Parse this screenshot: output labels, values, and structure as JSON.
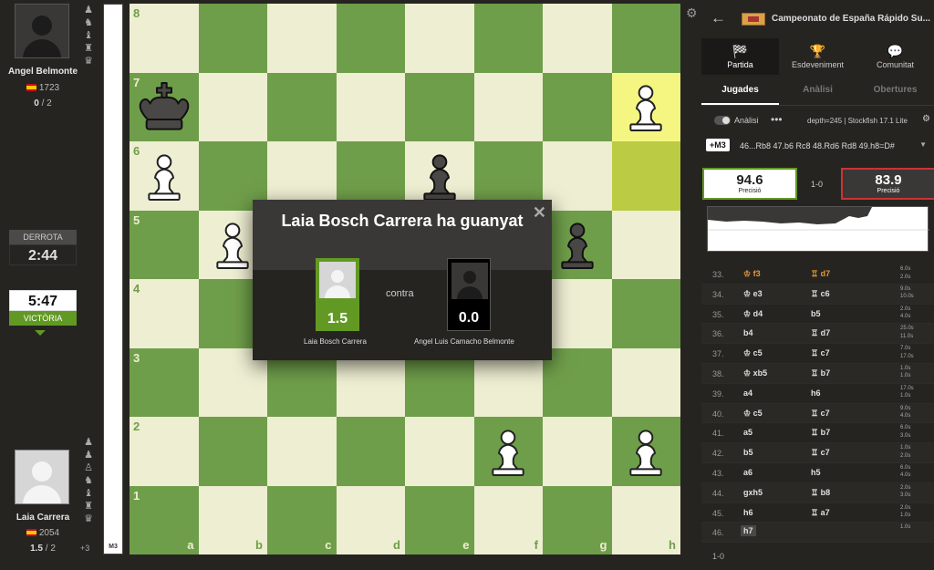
{
  "top_player": {
    "name": "Angel Belmonte",
    "rating": "1723",
    "score": "0",
    "score_total": "/ 2",
    "captured": [
      "♟",
      "♞",
      "♝",
      "♜",
      "♛"
    ]
  },
  "bottom_player": {
    "name": "Laia Carrera",
    "rating": "2054",
    "score": "1.5",
    "score_total": "/ 2",
    "captured": [
      "♟",
      "♟",
      "♙",
      "♞",
      "♝",
      "♜",
      "♛"
    ],
    "material_diff": "+3"
  },
  "clocks": {
    "top": {
      "label": "DERROTA",
      "time": "2:44"
    },
    "bottom": {
      "label": "VICTÒRIA",
      "time": "5:47"
    }
  },
  "eval_bar": {
    "label": "M3"
  },
  "board": {
    "ranks": [
      "8",
      "7",
      "6",
      "5",
      "4",
      "3",
      "2",
      "1"
    ],
    "files": [
      "a",
      "b",
      "c",
      "d",
      "e",
      "f",
      "g",
      "h"
    ]
  },
  "modal": {
    "title": "Laia Bosch Carrera ha guanyat",
    "close": "✕",
    "vs": "contra",
    "winner": {
      "name": "Laia Bosch Carrera",
      "score": "1.5"
    },
    "loser": {
      "name": "Angel Luis Camacho Belmonte",
      "score": "0.0"
    }
  },
  "panel": {
    "back": "←",
    "tournament": "Campeonato de España Rápido Su...",
    "main_tabs": [
      {
        "icon": "checkered-flag",
        "label": "Partida"
      },
      {
        "icon": "trophy",
        "label": "Esdeveniment"
      },
      {
        "icon": "chat",
        "label": "Comunitat"
      }
    ],
    "sub_tabs": [
      "Jugades",
      "Anàlisi",
      "Obertures"
    ],
    "analysis_label": "Anàlisi",
    "dots": "•••",
    "depth": "depth=245 | Stockfish 17.1 Lite",
    "pv_badge": "+M3",
    "pv_line": "46...Rb8 47.b6 Rc8 48.Rd6 Rd8 49.h8=D#",
    "accuracy": {
      "white": "94.6",
      "black": "83.9",
      "label": "Precisió",
      "result": "1-0"
    },
    "moves": [
      {
        "n": "33.",
        "w": "♔ f3",
        "b": "♖ d7",
        "t": [
          "6.0s",
          "2.0s"
        ]
      },
      {
        "n": "34.",
        "w": "♔ e3",
        "b": "♖ c6",
        "t": [
          "9.0s",
          "10.0s"
        ]
      },
      {
        "n": "35.",
        "w": "♔ d4",
        "b": "b5",
        "t": [
          "2.0s",
          "4.0s"
        ]
      },
      {
        "n": "36.",
        "w": "b4",
        "b": "♖ d7",
        "t": [
          "25.0s",
          "11.0s"
        ]
      },
      {
        "n": "37.",
        "w": "♔ c5",
        "b": "♖ c7",
        "t": [
          "7.0s",
          "17.0s"
        ]
      },
      {
        "n": "38.",
        "w": "♔ xb5",
        "b": "♖ b7",
        "t": [
          "1.0s",
          "1.0s"
        ]
      },
      {
        "n": "39.",
        "w": "a4",
        "b": "h6",
        "t": [
          "17.0s",
          "1.0s"
        ]
      },
      {
        "n": "40.",
        "w": "♔ c5",
        "b": "♖ c7",
        "t": [
          "9.0s",
          "4.0s"
        ]
      },
      {
        "n": "41.",
        "w": "a5",
        "b": "♖ b7",
        "t": [
          "6.0s",
          "3.0s"
        ]
      },
      {
        "n": "42.",
        "w": "b5",
        "b": "♖ c7",
        "t": [
          "1.0s",
          "2.0s"
        ]
      },
      {
        "n": "43.",
        "w": "a6",
        "b": "h5",
        "t": [
          "6.0s",
          "4.0s"
        ]
      },
      {
        "n": "44.",
        "w": "gxh5",
        "b": "♖ b8",
        "t": [
          "2.0s",
          "3.0s"
        ]
      },
      {
        "n": "45.",
        "w": "h6",
        "b": "♖ a7",
        "t": [
          "2.0s",
          "1.0s"
        ]
      },
      {
        "n": "46.",
        "w": "h7",
        "b": "",
        "t": [
          "1.0s",
          ""
        ]
      }
    ],
    "result": "1-0"
  },
  "colors": {
    "light_square": "#eeeed2",
    "dark_square": "#6f9e4a",
    "highlight_light": "#f5f682",
    "highlight_dark": "#bbcb43",
    "win_green": "#629924",
    "loss_red": "#cc3333",
    "accent_orange": "#e69a3c"
  }
}
